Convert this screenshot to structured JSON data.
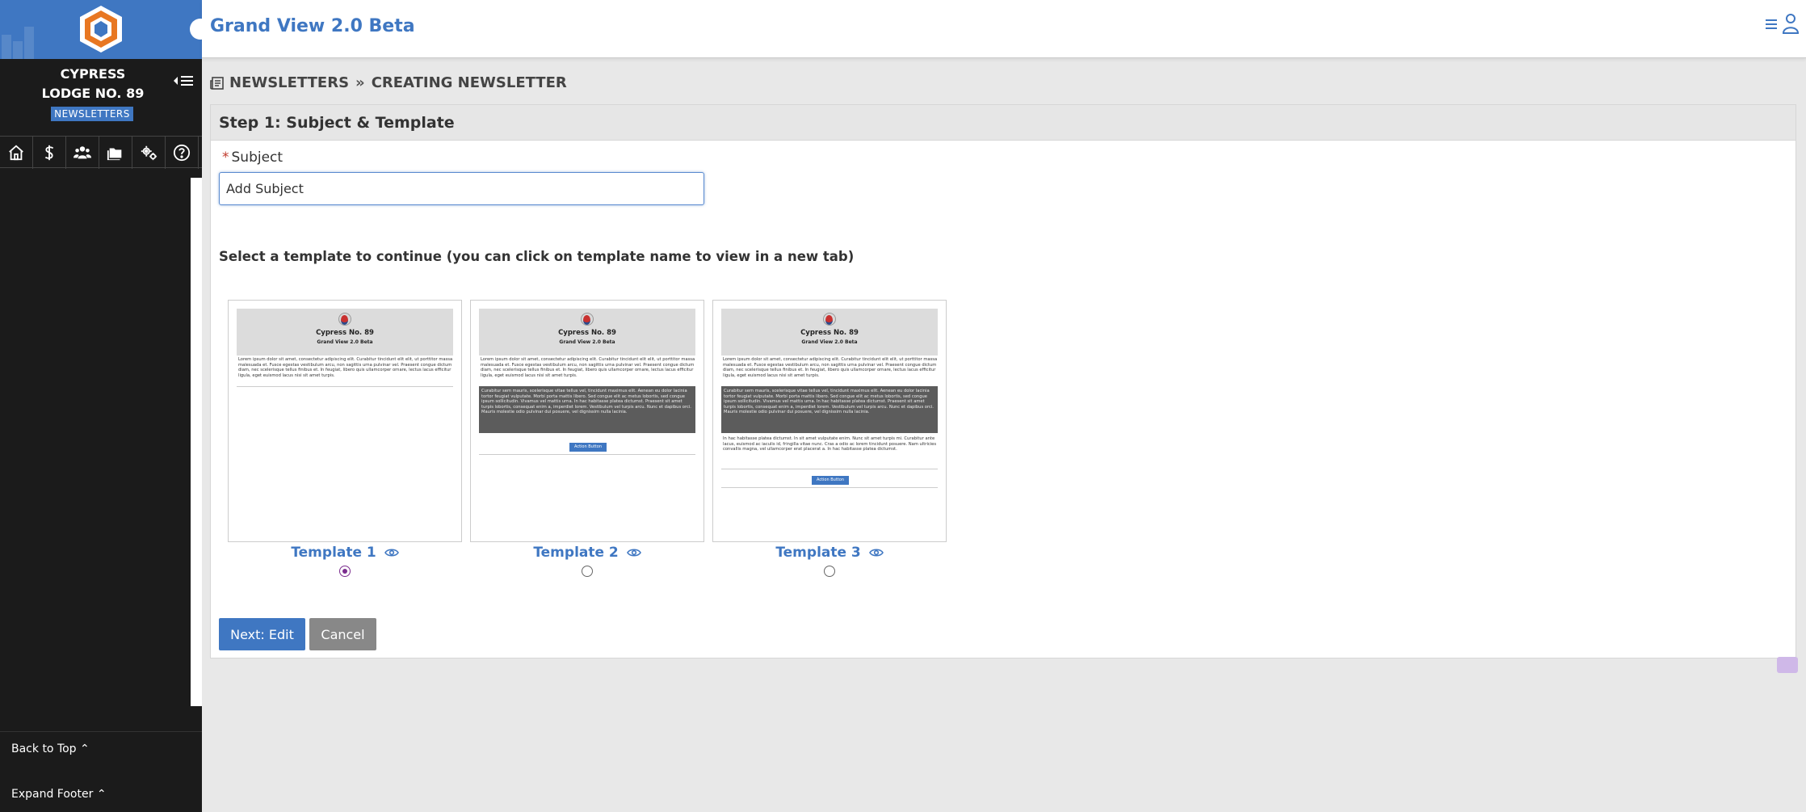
{
  "topbar": {
    "app_title": "Grand View 2.0 Beta"
  },
  "sidebar": {
    "lodge_line1": "CYPRESS",
    "lodge_line2": "LODGE NO. 89",
    "section_badge": "NEWSLETTERS",
    "nav_icons": [
      "home-icon",
      "dollar-icon",
      "members-icon",
      "folder-icon",
      "settings-icon",
      "help-icon"
    ],
    "back_to_top": "Back to Top",
    "expand_footer": "Expand Footer"
  },
  "breadcrumb": {
    "parent": "NEWSLETTERS",
    "current": "CREATING NEWSLETTER"
  },
  "card": {
    "step_title": "Step 1: Subject & Template",
    "required_mark": "*",
    "subject_label": "Subject",
    "subject_placeholder": "Add Subject",
    "template_instruction": "Select a template to continue (you can click on template name to view in a new tab)"
  },
  "templates": [
    {
      "label": "Template 1",
      "selected": true
    },
    {
      "label": "Template 2",
      "selected": false
    },
    {
      "label": "Template 3",
      "selected": false
    }
  ],
  "template_preview": {
    "name": "Cypress No. 89",
    "subtitle": "Grand View 2.0 Beta",
    "lorem1": "Lorem ipsum dolor sit amet, consectetur adipiscing elit. Curabitur tincidunt elit elit, ut porttitor massa malesuada et. Fusce egestas vestibulum arcu, non sagittis urna pulvinar vel. Praesent congue dictum diam, nec scelerisque tellus finibus et. In feugiat, libero quis ullamcorper ornare, lectus lacus efficitur ligula, eget euismod lacus nisi sit amet turpis.",
    "lorem2": "Curabitur sem mauris, scelerisque vitae tellus vel, tincidunt maximus elit. Aenean eu dolor lacinia tortor feugiat vulputate. Morbi porta mattis libero. Sed congue elit ac metus lobortis, sed congue ipsum sollicitudin. Vivamus vel mattis urna. In hac habitasse platea dictumst. Praesent sit amet turpis lobortis, consequat enim a, imperdiet lorem. Vestibulum vel turpis arcu. Nunc et dapibus orci. Mauris molestie odio pulvinar dui posuere, vel dignissim nulla lacinia.",
    "lorem3": "In hac habitasse platea dictumst. In sit amet vulputate enim. Nunc sit amet turpis mi. Curabitur ante lacus, euismod ac iaculis id, fringilla vitae nunc. Cras a odio ac lorem tincidunt posuere. Nam ultricies convallis magna, vel ullamcorper erat placerat a. In hac habitasse platea dictumst.",
    "action_button": "Action Button"
  },
  "buttons": {
    "next": "Next: Edit",
    "cancel": "Cancel"
  },
  "colors": {
    "brand_blue": "#3f77c2",
    "sidebar_bg": "#1b1b1b",
    "radio_checked": "#7b2d8e"
  }
}
